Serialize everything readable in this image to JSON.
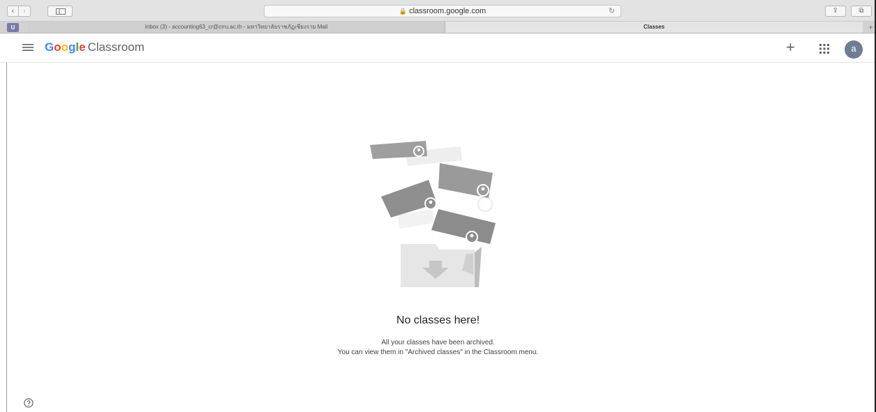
{
  "browser": {
    "url": "classroom.google.com",
    "tabs": [
      {
        "label": "Inbox (3) - accounting63_cr@crru.ac.th - มหาวิทยาลัยราชภัฏเชียงราย Mail"
      },
      {
        "label": "Classes"
      }
    ],
    "favorites_label": "U",
    "back_glyph": "‹",
    "forward_glyph": "›",
    "reload_glyph": "↻",
    "share_glyph": "⇪",
    "tabs_glyph": "⧉",
    "new_tab_glyph": "+"
  },
  "header": {
    "brand_letters": [
      {
        "char": "G",
        "color": "#4285F4"
      },
      {
        "char": "o",
        "color": "#EA4335"
      },
      {
        "char": "o",
        "color": "#FBBC05"
      },
      {
        "char": "g",
        "color": "#4285F4"
      },
      {
        "char": "l",
        "color": "#34A853"
      },
      {
        "char": "e",
        "color": "#EA4335"
      }
    ],
    "product": "Classroom",
    "plus_glyph": "+",
    "avatar_initial": "a"
  },
  "empty_state": {
    "title": "No classes here!",
    "line1": "All your classes have been archived.",
    "line2": "You can view them in \"Archived classes\" in the Classroom menu."
  },
  "icons": {
    "menu": "menu-icon",
    "apps": "apps-grid-icon",
    "help": "help-icon",
    "lock": "lock-icon"
  }
}
